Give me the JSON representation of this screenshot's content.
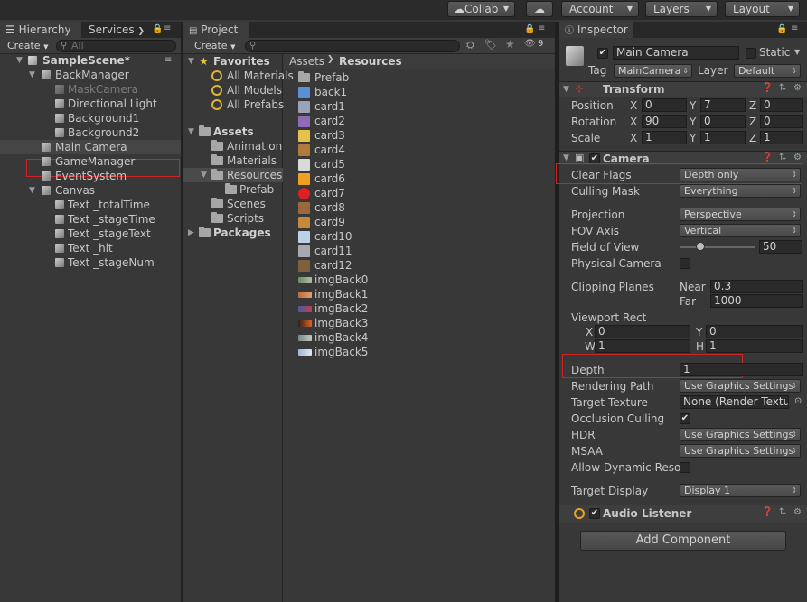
{
  "toolbar": {
    "collab": "Collab",
    "account": "Account",
    "layers": "Layers",
    "layout": "Layout"
  },
  "hierarchy": {
    "tab": "Hierarchy",
    "services_tab": "Services",
    "create": "Create",
    "search_placeholder": "All",
    "scene": "SampleScene*",
    "items": [
      {
        "label": "BackManager"
      },
      {
        "label": "MaskCamera"
      },
      {
        "label": "Directional Light"
      },
      {
        "label": "Background1"
      },
      {
        "label": "Background2"
      },
      {
        "label": "Main Camera"
      },
      {
        "label": "GameManager"
      },
      {
        "label": "EventSystem"
      },
      {
        "label": "Canvas"
      },
      {
        "label": "Text _totalTime"
      },
      {
        "label": "Text _stageTime"
      },
      {
        "label": "Text _stageText"
      },
      {
        "label": "Text _hit"
      },
      {
        "label": "Text _stageNum"
      }
    ]
  },
  "project": {
    "tab": "Project",
    "create": "Create",
    "badge_count": "9",
    "favorites_label": "Favorites",
    "favorites": [
      "All Materials",
      "All Models",
      "All Prefabs"
    ],
    "assets_label": "Assets",
    "assets_children": [
      "Animation",
      "Materials",
      "Resources",
      "Prefab",
      "Scenes",
      "Scripts"
    ],
    "packages_label": "Packages",
    "breadcrumb": {
      "root": "Assets",
      "current": "Resources"
    },
    "files": [
      "Prefab",
      "back1",
      "card1",
      "card2",
      "card3",
      "card4",
      "card5",
      "card6",
      "card7",
      "card8",
      "card9",
      "card10",
      "card11",
      "card12",
      "imgBack0",
      "imgBack1",
      "imgBack2",
      "imgBack3",
      "imgBack4",
      "imgBack5"
    ]
  },
  "inspector": {
    "tab": "Inspector",
    "object_name": "Main Camera",
    "static_label": "Static",
    "tag_label": "Tag",
    "tag_value": "MainCamera",
    "layer_label": "Layer",
    "layer_value": "Default",
    "transform": {
      "title": "Transform",
      "position_label": "Position",
      "rotation_label": "Rotation",
      "scale_label": "Scale",
      "x": "X",
      "y": "Y",
      "z": "Z",
      "position": [
        "0",
        "7",
        "0"
      ],
      "rotation": [
        "90",
        "0",
        "0"
      ],
      "scale": [
        "1",
        "1",
        "1"
      ]
    },
    "camera": {
      "title": "Camera",
      "clear_flags_label": "Clear Flags",
      "clear_flags": "Depth only",
      "culling_mask_label": "Culling Mask",
      "culling_mask": "Everything",
      "projection_label": "Projection",
      "projection": "Perspective",
      "fov_axis_label": "FOV Axis",
      "fov_axis": "Vertical",
      "fov_label": "Field of View",
      "fov": "50",
      "physical_label": "Physical Camera",
      "clipping_label": "Clipping Planes",
      "near_label": "Near",
      "near": "0.3",
      "far_label": "Far",
      "far": "1000",
      "viewport_label": "Viewport Rect",
      "vp_x_label": "X",
      "vp_x": "0",
      "vp_y_label": "Y",
      "vp_y": "0",
      "vp_w_label": "W",
      "vp_w": "1",
      "vp_h_label": "H",
      "vp_h": "1",
      "depth_label": "Depth",
      "depth": "1",
      "rendering_path_label": "Rendering Path",
      "rendering_path": "Use Graphics Settings",
      "target_texture_label": "Target Texture",
      "target_texture": "None (Render Textu",
      "occlusion_label": "Occlusion Culling",
      "hdr_label": "HDR",
      "hdr": "Use Graphics Settings",
      "msaa_label": "MSAA",
      "msaa": "Use Graphics Settings",
      "dyn_res_label": "Allow Dynamic Resol",
      "target_display_label": "Target Display",
      "target_display": "Display 1"
    },
    "audio_listener": "Audio Listener",
    "add_component": "Add Component"
  },
  "colors": {
    "highlight": "#d02424",
    "panel_bg": "#383838",
    "toolbar_bg": "#2b2b2b"
  }
}
